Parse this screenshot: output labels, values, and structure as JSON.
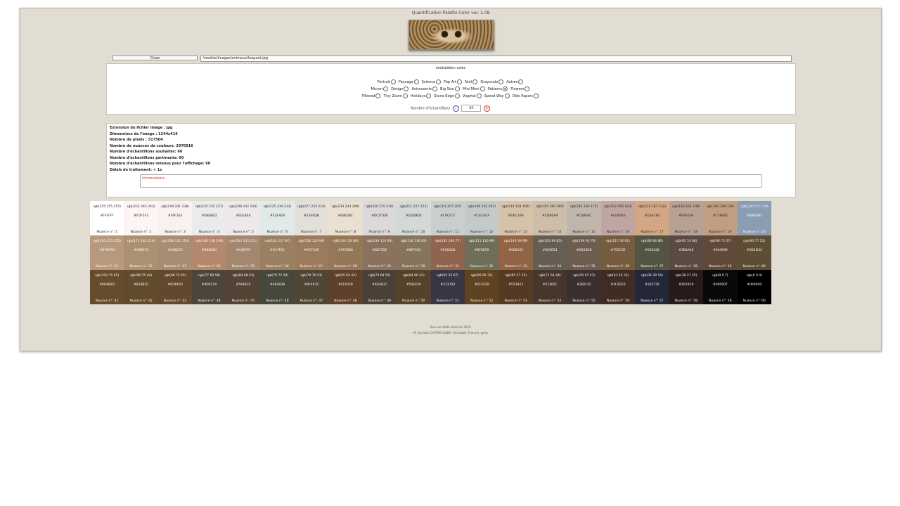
{
  "app": {
    "title": "Quantification Palette Color ver. 1.08"
  },
  "toolbar": {
    "clean_label": "Clean",
    "path_value": "/medias/images/animaux/leopard.jpg"
  },
  "modulation": {
    "title": "modulation color:",
    "rows": [
      [
        "Portrait",
        "Paysage",
        "Science",
        "Pop Art",
        "Nuit",
        "Grayscale",
        "Autres"
      ],
      [
        "Micron",
        "Design",
        "Astronomie",
        "Big Size",
        "Mini Mimi",
        "Patterns",
        "Flowers"
      ],
      [
        "Filtered",
        "Tiny Zoom",
        "Holidays",
        "Stone Edge",
        "Vegetal",
        "Speed Way",
        "Olds Papers"
      ]
    ],
    "selected": "Patterns",
    "samples_label": "Nombre d'échantillons",
    "samples_value": "60",
    "minus": "-",
    "plus": "+"
  },
  "stats": [
    "Extension du fichier image : jpg",
    "Dimensions de l'image : 1244x416",
    "Nombre de pixels : 517504",
    "Nombre de nuances de couleurs: 2070016",
    "Nombre d'échantillons souhaités: 60",
    "Nombre d'échantillons pertinents: 60",
    "Nombre d'échantillons retenus pour l'affichage: 60",
    "Délais de traitement: < 1s"
  ],
  "info_box": "Informations...",
  "palette": [
    {
      "rgb": "rgb(255 255 255)",
      "hex": "#FFFFFF",
      "label": "Nuance n°: 1"
    },
    {
      "rgb": "rgb(253 245 243)",
      "hex": "#FDF5F3",
      "label": "Nuance n°: 2"
    },
    {
      "rgb": "rgb(249 241 238)",
      "hex": "#F9F1EE",
      "label": "Nuance n°: 3"
    },
    {
      "rgb": "rgb(235 235 237)",
      "hex": "#EBEBED",
      "label": "Nuance n°: 4"
    },
    {
      "rgb": "rgb(238 232 234)",
      "hex": "#EEE8EA",
      "label": "Nuance n°: 5"
    },
    {
      "rgb": "rgb(225 234 233)",
      "hex": "#E1EAE9",
      "label": "Nuance n°: 6"
    },
    {
      "rgb": "rgb(227 224 219)",
      "hex": "#E3E0DB",
      "label": "Nuance n°: 7"
    },
    {
      "rgb": "rgb(233 224 209)",
      "hex": "#E9E0D1",
      "label": "Nuance n°: 8"
    },
    {
      "rgb": "rgb(220 215 219)",
      "hex": "#DCD7DB",
      "label": "Nuance n°: 9"
    },
    {
      "rgb": "rgb(211 217 213)",
      "hex": "#D3D9D5",
      "label": "Nuance n°: 10"
    },
    {
      "rgb": "rgb(201 207 207)",
      "hex": "#C9CFCF",
      "label": "Nuance n°: 11"
    },
    {
      "rgb": "rgb(196 202 202)",
      "hex": "#C4CACA",
      "label": "Nuance n°: 12"
    },
    {
      "rgb": "rgb(214 194 169)",
      "hex": "#D6C2A9",
      "label": "Nuance n°: 13"
    },
    {
      "rgb": "rgb(205 190 169)",
      "hex": "#CDBEA9",
      "label": "Nuance n°: 14"
    },
    {
      "rgb": "rgb(192 182 172)",
      "hex": "#C0B6AC",
      "label": "Nuance n°: 15"
    },
    {
      "rgb": "rgb(192 166 163)",
      "hex": "#C0A6A3",
      "label": "Nuance n°: 16"
    },
    {
      "rgb": "rgb(211 167 132)",
      "hex": "#D3A784",
      "label": "Nuance n°: 17"
    },
    {
      "rgb": "rgb(183 161 148)",
      "hex": "#B7A194",
      "label": "Nuance n°: 18"
    },
    {
      "rgb": "rgb(193 158 130)",
      "hex": "#C19E82",
      "label": "Nuance n°: 19"
    },
    {
      "rgb": "rgb(139 157 179)",
      "hex": "#8B9DB3",
      "label": "Nuance n°: 20"
    },
    {
      "rgb": "rgb(183 153 125)",
      "hex": "#B7997D",
      "label": "Nuance n°: 21"
    },
    {
      "rgb": "rgb(171 144 114)",
      "hex": "#AB9072",
      "label": "Nuance n°: 22"
    },
    {
      "rgb": "rgb(168 141 114)",
      "hex": "#A88D72",
      "label": "Nuance n°: 23"
    },
    {
      "rgb": "rgb(180 136 109)",
      "hex": "#B4886D",
      "label": "Nuance n°: 24"
    },
    {
      "rgb": "rgb(163 135 111)",
      "hex": "#A3876F",
      "label": "Nuance n°: 25"
    },
    {
      "rgb": "rgb(154 127 97)",
      "hex": "#9A7F61",
      "label": "Nuance n°: 26"
    },
    {
      "rgb": "rgb(156 122 94)",
      "hex": "#9C7A5E",
      "label": "Nuance n°: 27"
    },
    {
      "rgb": "rgb(149 120 88)",
      "hex": "#957858",
      "label": "Nuance n°: 28"
    },
    {
      "rgb": "rgb(139 114 94)",
      "hex": "#8B725E",
      "label": "Nuance n°: 29"
    },
    {
      "rgb": "rgb(134 116 92)",
      "hex": "#86745C",
      "label": "Nuance n°: 30"
    },
    {
      "rgb": "rgb(145 100 77)",
      "hex": "#91644D",
      "label": "Nuance n°: 31"
    },
    {
      "rgb": "rgb(111 110 89)",
      "hex": "#6F6E59",
      "label": "Nuance n°: 32"
    },
    {
      "rgb": "rgb(146 99 69)",
      "hex": "#926345",
      "label": "Nuance n°: 33"
    },
    {
      "rgb": "rgb(102 94 83)",
      "hex": "#665E53",
      "label": "Nuance n°: 34"
    },
    {
      "rgb": "rgb(109 93 78)",
      "hex": "#6D5D4E",
      "label": "Nuance n°: 35"
    },
    {
      "rgb": "rgb(117 92 62)",
      "hex": "#755C3E",
      "label": "Nuance n°: 36"
    },
    {
      "rgb": "rgb(83 84 66)",
      "hex": "#535442",
      "label": "Nuance n°: 37"
    },
    {
      "rgb": "rgb(91 74 66)",
      "hex": "#5B4A42",
      "label": "Nuance n°: 38"
    },
    {
      "rgb": "rgb(96 73 57)",
      "hex": "#604939",
      "label": "Nuance n°: 39"
    },
    {
      "rgb": "rgb(93 77 52)",
      "hex": "#5D4D34",
      "label": "Nuance n°: 40"
    },
    {
      "rgb": "rgb(102 75 45)",
      "hex": "#664B2D",
      "label": "Nuance n°: 41"
    },
    {
      "rgb": "rgb(98 75 44)",
      "hex": "#624B2C",
      "label": "Nuance n°: 42"
    },
    {
      "rgb": "rgb(98 72 45)",
      "hex": "#62482D",
      "label": "Nuance n°: 43"
    },
    {
      "rgb": "rgb(77 69 58)",
      "hex": "#4D453A",
      "label": "Nuance n°: 44"
    },
    {
      "rgb": "rgb(84 68 53)",
      "hex": "#544435",
      "label": "Nuance n°: 45"
    },
    {
      "rgb": "rgb(70 72 59)",
      "hex": "#46483B",
      "label": "Nuance n°: 46"
    },
    {
      "rgb": "rgb(79 70 53)",
      "hex": "#4F4635",
      "label": "Nuance n°: 47"
    },
    {
      "rgb": "rgb(95 64 43)",
      "hex": "#5F402B",
      "label": "Nuance n°: 48"
    },
    {
      "rgb": "rgb(74 64 55)",
      "hex": "#4A4037",
      "label": "Nuance n°: 49"
    },
    {
      "rgb": "rgb(84 66 42)",
      "hex": "#54422A",
      "label": "Nuance n°: 50"
    },
    {
      "rgb": "rgb(55 55 67)",
      "hex": "#373743",
      "label": "Nuance n°: 51"
    },
    {
      "rgb": "rgb(95 66 32)",
      "hex": "#5F4220",
      "label": "Nuance n°: 52"
    },
    {
      "rgb": "rgb(85 57 35)",
      "hex": "#553923",
      "label": "Nuance n°: 53"
    },
    {
      "rgb": "rgb(71 54 44)",
      "hex": "#47362C",
      "label": "Nuance n°: 54"
    },
    {
      "rgb": "rgb(59 47 47)",
      "hex": "#3B2F2F",
      "label": "Nuance n°: 55"
    },
    {
      "rgb": "rgb(63 45 35)",
      "hex": "#3F2D23",
      "label": "Nuance n°: 56"
    },
    {
      "rgb": "rgb(36 39 54)",
      "hex": "#242736",
      "label": "Nuance n°: 57"
    },
    {
      "rgb": "rgb(38 27 25)",
      "hex": "#261B19",
      "label": "Nuance n°: 58"
    },
    {
      "rgb": "rgb(9 9 7)",
      "hex": "#090907",
      "label": "Nuance n°: 59"
    },
    {
      "rgb": "rgb(0 0 0)",
      "hex": "#000000",
      "label": "Nuance n°: 60"
    }
  ],
  "footer": {
    "line1": "Tous les droits réservés 2025.",
    "line2": "M. German CASTRO (ALBA) (Grenoble, France). @me"
  }
}
